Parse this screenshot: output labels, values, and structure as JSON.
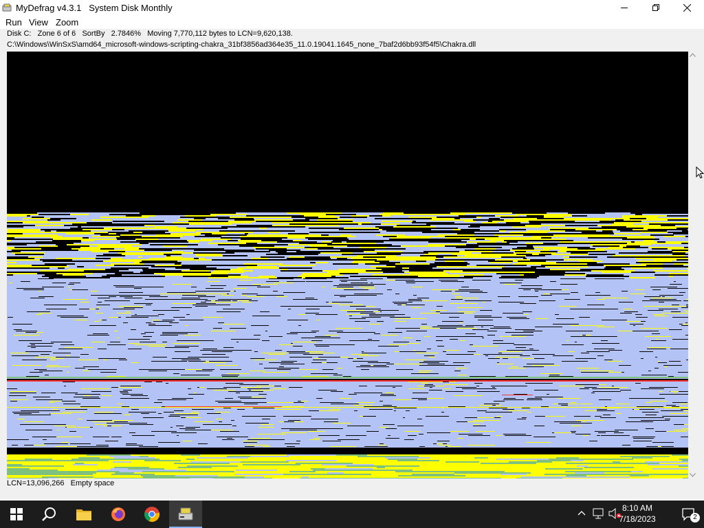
{
  "window": {
    "app_name": "MyDefrag v4.3.1",
    "script_name": "System Disk Monthly"
  },
  "menu": [
    "Run",
    "View",
    "Zoom"
  ],
  "status": {
    "disk": "Disk C:",
    "zone": "Zone 6 of 6",
    "action": "SortBy",
    "percent": "2.7846%",
    "message": "Moving 7,770,112 bytes to LCN=9,620,138.",
    "path": "C:\\Windows\\WinSxS\\amd64_microsoft-windows-scripting-chakra_31bf3856ad364e35_11.0.19041.1645_none_7baf2d6bb93f54f5\\Chakra.dll",
    "lcn": "LCN=13,096,266",
    "legend": "Empty space"
  },
  "colors": {
    "empty_space": "#b3c3f5",
    "unmovable": "#000000",
    "fragmented": "#ff3030",
    "busy": "#ffff00",
    "mft": "#7ec07e"
  },
  "taskbar": {
    "apps": [
      "windows-start-icon",
      "search-icon",
      "file-explorer-icon",
      "firefox-icon",
      "chrome-icon",
      "mydefrag-icon"
    ],
    "time": "8:10 AM",
    "date": "7/18/2023",
    "notification_count": "2"
  }
}
